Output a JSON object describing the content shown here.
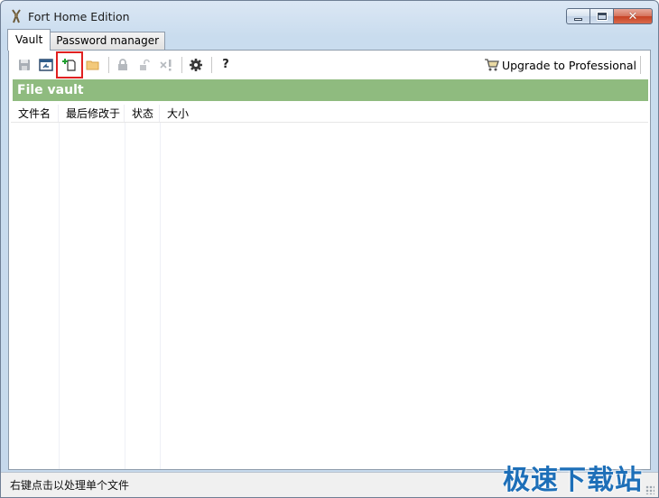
{
  "window": {
    "title": "Fort Home Edition"
  },
  "tabs": [
    {
      "label": "Vault",
      "active": true
    },
    {
      "label": "Password manager",
      "active": false
    }
  ],
  "toolbar": {
    "items": [
      "save-icon",
      "open-vault-icon",
      "new-file-icon",
      "open-folder-icon",
      "lock-icon",
      "unlock-icon",
      "delete-icon",
      "settings-icon",
      "help-icon"
    ],
    "help_label": "?",
    "upgrade_label": "Upgrade to Professional"
  },
  "vault": {
    "header": "File vault"
  },
  "columns": [
    "文件名",
    "最后修改于",
    "状态",
    "大小"
  ],
  "status": {
    "text": "右键点击以处理单个文件"
  },
  "watermark": {
    "text": "极速下载站"
  },
  "colors": {
    "vault_header": "#8fbb7f",
    "highlight": "#e02020",
    "watermark": "#1d6fb8"
  }
}
